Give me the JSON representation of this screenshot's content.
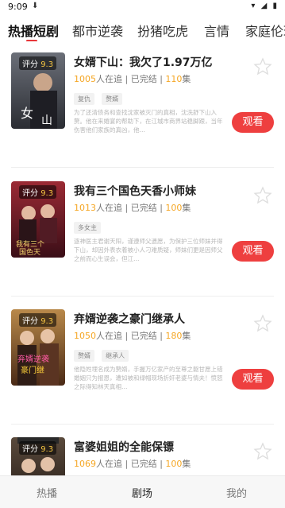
{
  "status_bar": {
    "time": "9:09",
    "download_icon": "download-icon",
    "icons": "▾◢▮"
  },
  "tabs": [
    {
      "label": "热播短剧"
    },
    {
      "label": "都市逆袭"
    },
    {
      "label": "扮猪吃虎"
    },
    {
      "label": "言情"
    },
    {
      "label": "家庭伦理"
    }
  ],
  "rating_prefix": "评分",
  "watch_label": "观看",
  "dramas": [
    {
      "title": "女婿下山：我欠了1.97万亿",
      "followers": "1005",
      "followers_suffix": "人在追",
      "status": "已完结",
      "episodes": "110",
      "episodes_suffix": "集",
      "rating": "9.3",
      "tags": [
        "复仇",
        "赘婿"
      ],
      "description": "为了还清债务和查找沈家被灭门的真相，沈洗舒下山入赘。他在来婚宴的帮助下，在江城市商界站稳脚跟，当年伤害他们家族的真凶，他…"
    },
    {
      "title": "我有三个国色天香小师妹",
      "followers": "1013",
      "followers_suffix": "人在追",
      "status": "已完结",
      "episodes": "100",
      "episodes_suffix": "集",
      "rating": "9.3",
      "tags": [
        "多女主"
      ],
      "description": "逐神医主君谢天阳，谨遵师父遗愿，为保护三位师妹并得下山，却因外表衣着被小人刁难质疑，师妹们更是因师父之前而心生误会，但江…"
    },
    {
      "title": "弃婿逆袭之豪门继承人",
      "followers": "1050",
      "followers_suffix": "人在追",
      "status": "已完结",
      "episodes": "180",
      "episodes_suffix": "集",
      "rating": "9.3",
      "tags": [
        "赘婿",
        "继承人"
      ],
      "description": "他隐姓埋名成为赘婿，手握万亿家产的至尊之躯甘愿上错婚姻只为报恩，遭如被和绿帽现场折奸老婆与情夫！愤怒之际得知林天真相…"
    },
    {
      "title": "富婆姐姐的全能保镖",
      "followers": "1069",
      "followers_suffix": "人在追",
      "status": "已完结",
      "episodes": "100",
      "episodes_suffix": "集",
      "rating": "9.3",
      "tags": [],
      "description": ""
    }
  ],
  "bottom_nav": [
    {
      "label": "热播"
    },
    {
      "label": "剧场"
    },
    {
      "label": "我的"
    }
  ],
  "colors": {
    "accent": "#ee3f3f",
    "highlight": "#f5a623",
    "tab_underline": "#e8373a"
  }
}
